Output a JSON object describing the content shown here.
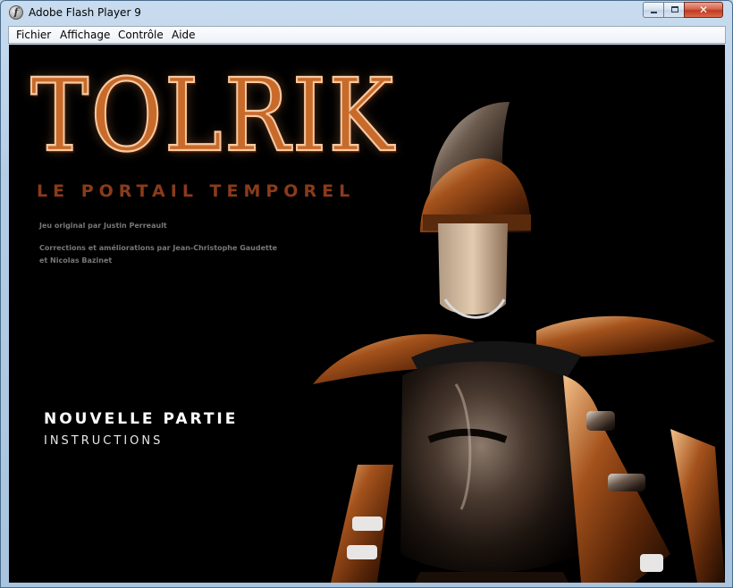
{
  "window": {
    "title": "Adobe Flash Player 9",
    "controls": {
      "minimize": "minimize-icon",
      "maximize": "maximize-icon",
      "close": "close-icon"
    }
  },
  "menubar": {
    "items": [
      "Fichier",
      "Affichage",
      "Contrôle",
      "Aide"
    ]
  },
  "game": {
    "logo": "TOLRIK",
    "subtitle": "LE PORTAIL TEMPOREL",
    "credits": [
      "Jeu original par Justin Perreault",
      "Corrections et améliorations par Jean-Christophe Gaudette",
      "et Nicolas Bazinet"
    ],
    "menu": {
      "new_game": "NOUVELLE PARTIE",
      "instructions": "INSTRUCTIONS"
    }
  },
  "colors": {
    "logo": "#c86a2a",
    "subtitle": "#8a3b1a",
    "stage_bg": "#000000",
    "menu_text": "#ffffff"
  }
}
